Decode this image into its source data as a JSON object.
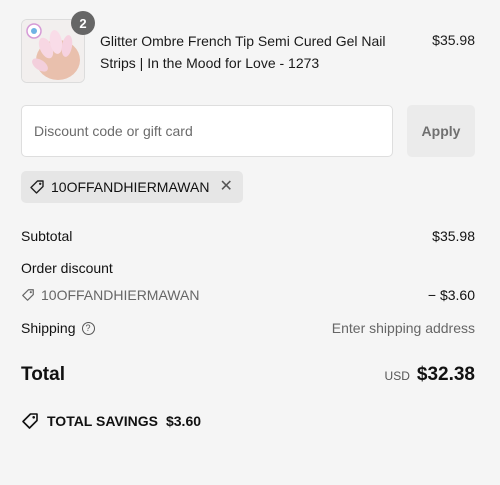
{
  "product": {
    "quantity": "2",
    "title": "Glitter Ombre French Tip Semi Cured Gel Nail Strips | In the Mood for Love - 1273",
    "price": "$35.98",
    "thumb_icon": "nail-product-thumbnail"
  },
  "discount": {
    "placeholder": "Discount code or gift card",
    "apply_label": "Apply",
    "applied_code": "10OFFANDHIERMAWAN"
  },
  "summary": {
    "subtotal_label": "Subtotal",
    "subtotal_value": "$35.98",
    "order_discount_label": "Order discount",
    "discount_code": "10OFFANDHIERMAWAN",
    "discount_value": "− $3.60",
    "shipping_label": "Shipping",
    "shipping_value": "Enter shipping address",
    "total_label": "Total",
    "currency": "USD",
    "total_value": "$32.38",
    "savings_label": "TOTAL SAVINGS",
    "savings_value": "$3.60"
  },
  "colors": {
    "background": "#f5f5f5",
    "badge": "#666666",
    "apply_bg": "#ebebeb",
    "chip_bg": "#e6e6e6"
  }
}
